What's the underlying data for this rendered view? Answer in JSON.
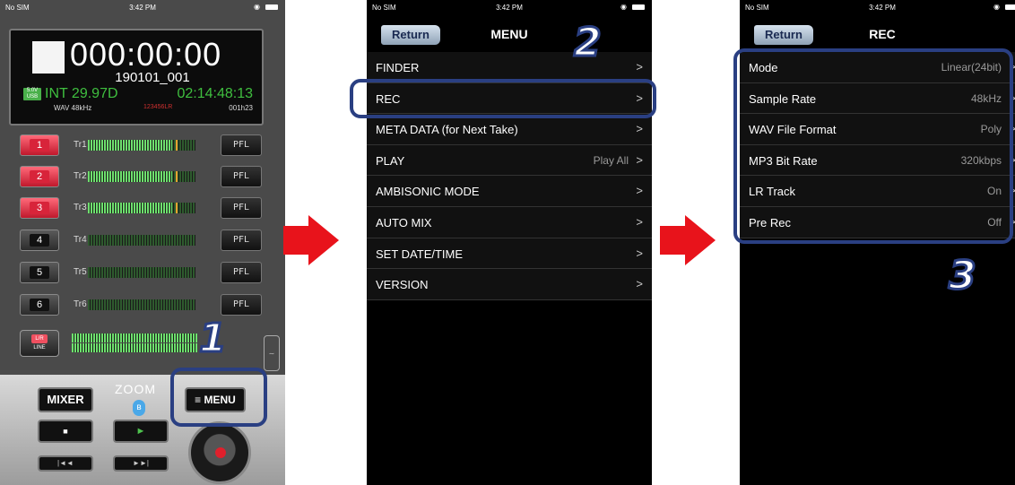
{
  "status": {
    "carrier": "No SIM",
    "time": "3:42 PM"
  },
  "recorder": {
    "timecode": "000:00:00",
    "take_name": "190101_001",
    "power_badge": "5.0V USB",
    "timecode_mode": "INT 29.97D",
    "timecode_value": "02:14:48:13",
    "format": "WAV 48kHz",
    "track_indicator": "123456LR",
    "remaining": "001h23",
    "tracks": [
      {
        "num": "1",
        "name": "Tr1",
        "armed": true,
        "level": 0.78
      },
      {
        "num": "2",
        "name": "Tr2",
        "armed": true,
        "level": 0.78
      },
      {
        "num": "3",
        "name": "Tr3",
        "armed": true,
        "level": 0.78
      },
      {
        "num": "4",
        "name": "Tr4",
        "armed": false,
        "level": 0
      },
      {
        "num": "5",
        "name": "Tr5",
        "armed": false,
        "level": 0
      },
      {
        "num": "6",
        "name": "Tr6",
        "armed": false,
        "level": 0
      }
    ],
    "pfl_label": "PFL",
    "lr_label": "L/R",
    "line_label": "LINE",
    "mixer_label": "MIXER",
    "logo": "ZOOM",
    "menu_label": "≡ MENU",
    "stop_glyph": "■",
    "play_glyph": "►",
    "rew_glyph": "|◄◄",
    "ff_glyph": "►►|"
  },
  "menu_screen": {
    "return_label": "Return",
    "title": "MENU",
    "items": [
      {
        "label": "FINDER",
        "value": ""
      },
      {
        "label": "REC",
        "value": ""
      },
      {
        "label": "META DATA (for Next Take)",
        "value": ""
      },
      {
        "label": "PLAY",
        "value": "Play All"
      },
      {
        "label": "AMBISONIC MODE",
        "value": ""
      },
      {
        "label": "AUTO MIX",
        "value": ""
      },
      {
        "label": "SET DATE/TIME",
        "value": ""
      },
      {
        "label": "VERSION",
        "value": ""
      }
    ]
  },
  "rec_screen": {
    "return_label": "Return",
    "title": "REC",
    "items": [
      {
        "label": "Mode",
        "value": "Linear(24bit)"
      },
      {
        "label": "Sample Rate",
        "value": "48kHz"
      },
      {
        "label": "WAV File Format",
        "value": "Poly"
      },
      {
        "label": "MP3 Bit Rate",
        "value": "320kbps"
      },
      {
        "label": "LR Track",
        "value": "On"
      },
      {
        "label": "Pre Rec",
        "value": "Off"
      }
    ]
  },
  "chevron": ">",
  "callouts": [
    "1",
    "2",
    "3"
  ],
  "colors": {
    "callout": "#2a3f82",
    "arrow": "#e8131b",
    "level": "#6ee06e",
    "rec_red": "#d8243a"
  }
}
